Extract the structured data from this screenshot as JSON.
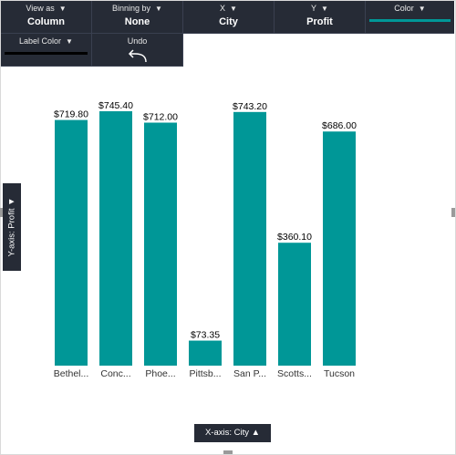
{
  "toolbar": {
    "view_as": {
      "caption": "View as",
      "value": "Column"
    },
    "binning": {
      "caption": "Binning by",
      "value": "None"
    },
    "x": {
      "caption": "X",
      "value": "City"
    },
    "y": {
      "caption": "Y",
      "value": "Profit"
    },
    "color": {
      "caption": "Color",
      "swatch": "#009797"
    },
    "label_color": {
      "caption": "Label Color",
      "swatch": "#000000"
    },
    "undo": {
      "caption": "Undo",
      "icon": "undo-icon"
    }
  },
  "yaxis_button": {
    "label": "Y-axis: Profit"
  },
  "xaxis_button": {
    "label": "X-axis: City"
  },
  "colors": {
    "toolbar_bg": "#262b36",
    "bar": "#009797"
  },
  "chart_data": {
    "type": "bar",
    "categories": [
      "Bethel...",
      "Conc...",
      "Phoe...",
      "Pittsb...",
      "San P...",
      "Scotts...",
      "Tucson"
    ],
    "values": [
      719.8,
      745.4,
      712.0,
      73.35,
      743.2,
      360.1,
      686.0
    ],
    "data_labels": [
      "$719.80",
      "$745.40",
      "$712.00",
      "$73.35",
      "$743.20",
      "$360.10",
      "$686.00"
    ],
    "xlabel": "City",
    "ylabel": "Profit",
    "ylim": [
      0,
      745.4
    ],
    "grid": false
  }
}
